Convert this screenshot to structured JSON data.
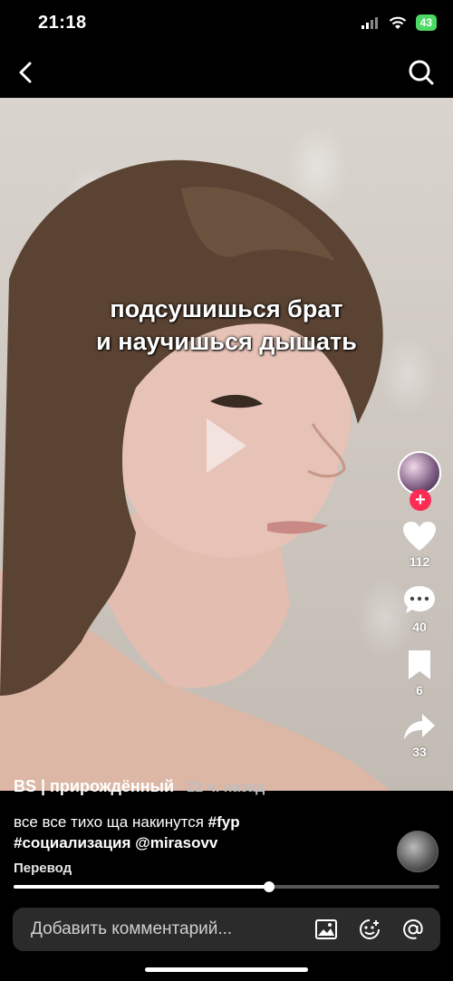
{
  "status": {
    "time": "21:18",
    "battery": "43"
  },
  "nav": {
    "back_icon": "chevron-left-icon",
    "search_icon": "search-icon"
  },
  "video": {
    "overlay_line1": "подсушишься брат",
    "overlay_line2": "и научишься дышать",
    "play_icon": "play-icon"
  },
  "actions": {
    "follow_icon": "plus-icon",
    "likes": "112",
    "comments": "40",
    "saves": "6",
    "shares": "33"
  },
  "post": {
    "username": "BS | прирождённый",
    "timeago": " · 22 ч. назад",
    "caption_text": "все все тихо ща накинутся ",
    "tag1": "#fyp",
    "tag2": "#социализация",
    "mention": "@mirasovv",
    "translate": "Перевод"
  },
  "playback": {
    "progress": 0.6
  },
  "comment_bar": {
    "placeholder": "Добавить комментарий..."
  },
  "colors": {
    "accent": "#fe2c55",
    "battery": "#4cd964"
  }
}
